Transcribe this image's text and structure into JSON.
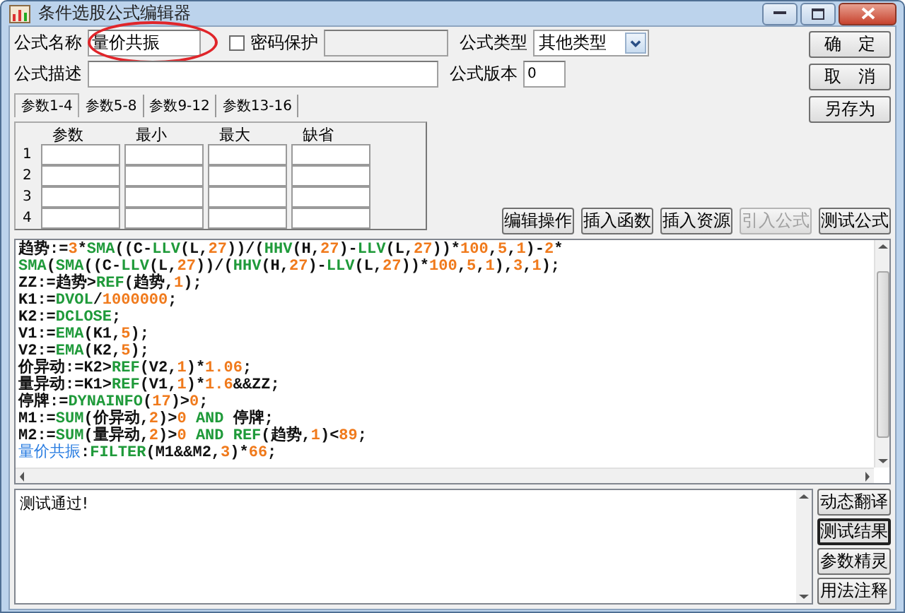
{
  "window": {
    "title": "条件选股公式编辑器"
  },
  "name_field": {
    "label": "公式名称",
    "value": "量价共振"
  },
  "annotation": {
    "kind": "ellipse",
    "color": "#e0252a"
  },
  "password": {
    "label": "密码保护",
    "checked": false,
    "disabled": true
  },
  "type_field": {
    "label": "公式类型",
    "value": "其他类型"
  },
  "desc_field": {
    "label": "公式描述"
  },
  "version_field": {
    "label": "公式版本",
    "value": "0"
  },
  "side_buttons": [
    {
      "label": "确　定"
    },
    {
      "label": "取　消"
    },
    {
      "label": "另存为"
    }
  ],
  "tabs": [
    {
      "label": "参数1-4",
      "selected": true
    },
    {
      "label": "参数5-8",
      "selected": false
    },
    {
      "label": "参数9-12",
      "selected": false
    },
    {
      "label": "参数13-16",
      "selected": false
    }
  ],
  "param_table": {
    "columns": [
      "参数",
      "最小",
      "最大",
      "缺省"
    ],
    "rows": [
      "1",
      "2",
      "3",
      "4"
    ]
  },
  "editor_buttons": [
    {
      "label": "编辑操作",
      "disabled": false
    },
    {
      "label": "插入函数",
      "disabled": false
    },
    {
      "label": "插入资源",
      "disabled": false
    },
    {
      "label": "引入公式",
      "disabled": true
    },
    {
      "label": "测试公式",
      "disabled": false
    }
  ],
  "code_lines": [
    [
      {
        "kind": "plain",
        "text": "趋势:="
      },
      {
        "kind": "num",
        "text": "3"
      },
      {
        "kind": "plain",
        "text": "*"
      },
      {
        "kind": "func",
        "text": "SMA"
      },
      {
        "kind": "plain",
        "text": "((C-"
      },
      {
        "kind": "func",
        "text": "LLV"
      },
      {
        "kind": "plain",
        "text": "(L,"
      },
      {
        "kind": "num",
        "text": "27"
      },
      {
        "kind": "plain",
        "text": "))/("
      },
      {
        "kind": "func",
        "text": "HHV"
      },
      {
        "kind": "plain",
        "text": "(H,"
      },
      {
        "kind": "num",
        "text": "27"
      },
      {
        "kind": "plain",
        "text": ")-"
      },
      {
        "kind": "func",
        "text": "LLV"
      },
      {
        "kind": "plain",
        "text": "(L,"
      },
      {
        "kind": "num",
        "text": "27"
      },
      {
        "kind": "plain",
        "text": "))*"
      },
      {
        "kind": "num",
        "text": "100"
      },
      {
        "kind": "plain",
        "text": ","
      },
      {
        "kind": "num",
        "text": "5"
      },
      {
        "kind": "plain",
        "text": ","
      },
      {
        "kind": "num",
        "text": "1"
      },
      {
        "kind": "plain",
        "text": ")-"
      },
      {
        "kind": "num",
        "text": "2"
      },
      {
        "kind": "plain",
        "text": "*"
      }
    ],
    [
      {
        "kind": "func",
        "text": "SMA"
      },
      {
        "kind": "plain",
        "text": "("
      },
      {
        "kind": "func",
        "text": "SMA"
      },
      {
        "kind": "plain",
        "text": "((C-"
      },
      {
        "kind": "func",
        "text": "LLV"
      },
      {
        "kind": "plain",
        "text": "(L,"
      },
      {
        "kind": "num",
        "text": "27"
      },
      {
        "kind": "plain",
        "text": "))/("
      },
      {
        "kind": "func",
        "text": "HHV"
      },
      {
        "kind": "plain",
        "text": "(H,"
      },
      {
        "kind": "num",
        "text": "27"
      },
      {
        "kind": "plain",
        "text": ")-"
      },
      {
        "kind": "func",
        "text": "LLV"
      },
      {
        "kind": "plain",
        "text": "(L,"
      },
      {
        "kind": "num",
        "text": "27"
      },
      {
        "kind": "plain",
        "text": "))*"
      },
      {
        "kind": "num",
        "text": "100"
      },
      {
        "kind": "plain",
        "text": ","
      },
      {
        "kind": "num",
        "text": "5"
      },
      {
        "kind": "plain",
        "text": ","
      },
      {
        "kind": "num",
        "text": "1"
      },
      {
        "kind": "plain",
        "text": "),"
      },
      {
        "kind": "num",
        "text": "3"
      },
      {
        "kind": "plain",
        "text": ","
      },
      {
        "kind": "num",
        "text": "1"
      },
      {
        "kind": "plain",
        "text": ");"
      }
    ],
    [
      {
        "kind": "plain",
        "text": "ZZ:=趋势>"
      },
      {
        "kind": "func",
        "text": "REF"
      },
      {
        "kind": "plain",
        "text": "(趋势,"
      },
      {
        "kind": "num",
        "text": "1"
      },
      {
        "kind": "plain",
        "text": ");"
      }
    ],
    [
      {
        "kind": "plain",
        "text": "K1:="
      },
      {
        "kind": "func",
        "text": "DVOL"
      },
      {
        "kind": "plain",
        "text": "/"
      },
      {
        "kind": "num",
        "text": "1000000"
      },
      {
        "kind": "plain",
        "text": ";"
      }
    ],
    [
      {
        "kind": "plain",
        "text": "K2:="
      },
      {
        "kind": "func",
        "text": "DCLOSE"
      },
      {
        "kind": "plain",
        "text": ";"
      }
    ],
    [
      {
        "kind": "plain",
        "text": "V1:="
      },
      {
        "kind": "func",
        "text": "EMA"
      },
      {
        "kind": "plain",
        "text": "(K1,"
      },
      {
        "kind": "num",
        "text": "5"
      },
      {
        "kind": "plain",
        "text": ");"
      }
    ],
    [
      {
        "kind": "plain",
        "text": "V2:="
      },
      {
        "kind": "func",
        "text": "EMA"
      },
      {
        "kind": "plain",
        "text": "(K2,"
      },
      {
        "kind": "num",
        "text": "5"
      },
      {
        "kind": "plain",
        "text": ");"
      }
    ],
    [
      {
        "kind": "plain",
        "text": "价异动:=K2>"
      },
      {
        "kind": "func",
        "text": "REF"
      },
      {
        "kind": "plain",
        "text": "(V2,"
      },
      {
        "kind": "num",
        "text": "1"
      },
      {
        "kind": "plain",
        "text": ")*"
      },
      {
        "kind": "num",
        "text": "1.06"
      },
      {
        "kind": "plain",
        "text": ";"
      }
    ],
    [
      {
        "kind": "plain",
        "text": "量异动:=K1>"
      },
      {
        "kind": "func",
        "text": "REF"
      },
      {
        "kind": "plain",
        "text": "(V1,"
      },
      {
        "kind": "num",
        "text": "1"
      },
      {
        "kind": "plain",
        "text": ")*"
      },
      {
        "kind": "num",
        "text": "1.6"
      },
      {
        "kind": "plain",
        "text": "&&ZZ;"
      }
    ],
    [
      {
        "kind": "plain",
        "text": "停牌:="
      },
      {
        "kind": "func",
        "text": "DYNAINFO"
      },
      {
        "kind": "plain",
        "text": "("
      },
      {
        "kind": "num",
        "text": "17"
      },
      {
        "kind": "plain",
        "text": ")>"
      },
      {
        "kind": "num",
        "text": "0"
      },
      {
        "kind": "plain",
        "text": ";"
      }
    ],
    [
      {
        "kind": "plain",
        "text": "M1:="
      },
      {
        "kind": "func",
        "text": "SUM"
      },
      {
        "kind": "plain",
        "text": "(价异动,"
      },
      {
        "kind": "num",
        "text": "2"
      },
      {
        "kind": "plain",
        "text": ")>"
      },
      {
        "kind": "num",
        "text": "0"
      },
      {
        "kind": "func",
        "text": " AND "
      },
      {
        "kind": "plain",
        "text": "停牌;"
      }
    ],
    [
      {
        "kind": "plain",
        "text": "M2:="
      },
      {
        "kind": "func",
        "text": "SUM"
      },
      {
        "kind": "plain",
        "text": "(量异动,"
      },
      {
        "kind": "num",
        "text": "2"
      },
      {
        "kind": "plain",
        "text": ")>"
      },
      {
        "kind": "num",
        "text": "0"
      },
      {
        "kind": "func",
        "text": " AND REF"
      },
      {
        "kind": "plain",
        "text": "(趋势,"
      },
      {
        "kind": "num",
        "text": "1"
      },
      {
        "kind": "plain",
        "text": ")<"
      },
      {
        "kind": "num",
        "text": "89"
      },
      {
        "kind": "plain",
        "text": ";"
      }
    ],
    [
      {
        "kind": "name",
        "text": "量价共振"
      },
      {
        "kind": "plain",
        "text": ":"
      },
      {
        "kind": "func",
        "text": "FILTER"
      },
      {
        "kind": "plain",
        "text": "(M1&&M2,"
      },
      {
        "kind": "num",
        "text": "3"
      },
      {
        "kind": "plain",
        "text": ")*"
      },
      {
        "kind": "num",
        "text": "66"
      },
      {
        "kind": "plain",
        "text": ";"
      }
    ]
  ],
  "output": {
    "text": "测试通过!"
  },
  "output_buttons": [
    {
      "label": "动态翻译",
      "selected": false
    },
    {
      "label": "测试结果",
      "selected": true
    },
    {
      "label": "参数精灵",
      "selected": false
    },
    {
      "label": "用法注释",
      "selected": false
    }
  ]
}
